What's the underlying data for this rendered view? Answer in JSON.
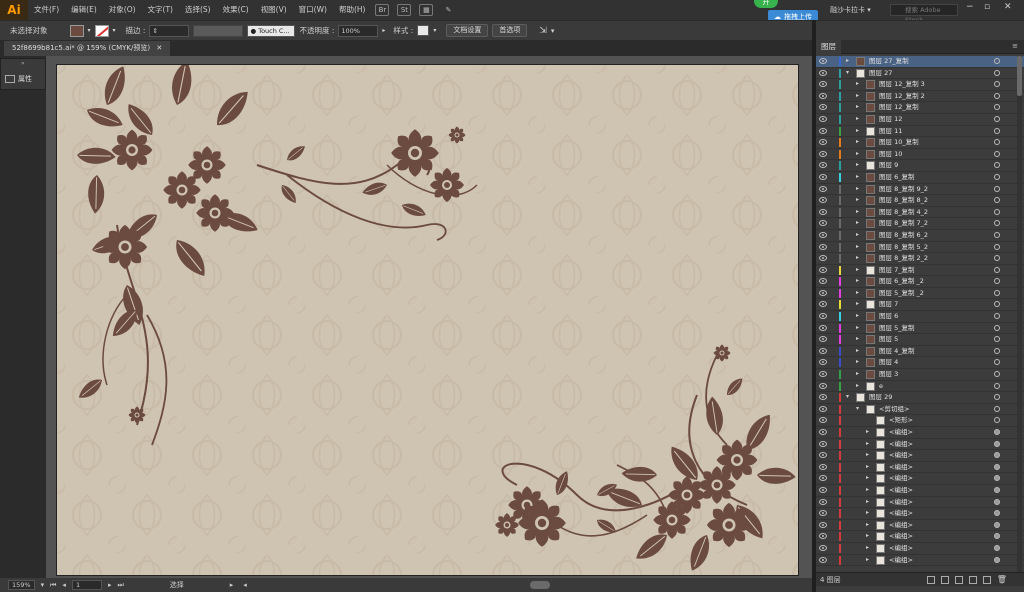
{
  "app": {
    "logo": "Ai",
    "menu": [
      "文件(F)",
      "编辑(E)",
      "对象(O)",
      "文字(T)",
      "选择(S)",
      "效果(C)",
      "视图(V)",
      "窗口(W)",
      "帮助(H)"
    ],
    "menu_icons": [
      "Br",
      "St",
      "grid-icon",
      "brush-launch-icon"
    ],
    "sync_label": "拖拽上传",
    "green_badge": "开",
    "workspace": "融沙卡拉卡",
    "stock_placeholder": "搜索 Adobe Stock"
  },
  "controlbar": {
    "selection_status": "未选择对象",
    "stroke_label": "描边 :",
    "brush": "Touch C...",
    "opacity_label": "不透明度 :",
    "opacity_value": "100%",
    "style_label": "样式 :",
    "doc_setup": "文档设置",
    "preferences": "首选项"
  },
  "document": {
    "tab_title": "52f8699b81c5.ai* @ 159% (CMYK/预览)"
  },
  "tools": {
    "properties_label": "属性"
  },
  "statusbar": {
    "zoom": "159%",
    "artboard_num": "1",
    "tool_status": "选择"
  },
  "colors": {
    "artboard_bg": "#cfc3b1",
    "ornament": "#6b4a40",
    "selected_row": "#4a6284"
  },
  "layers": {
    "tab_label": "图层",
    "footer_count": "4 图层",
    "rows": [
      {
        "name": "图层 27_复制",
        "indent": 0,
        "expand": "right",
        "color": "#3b6ad6",
        "thumb": "dark",
        "selected": true,
        "target": false
      },
      {
        "name": "图层 27",
        "indent": 0,
        "expand": "down",
        "color": "#2e9e9e",
        "thumb": "light",
        "selected": false,
        "target": false
      },
      {
        "name": "图层 12_复制 3",
        "indent": 1,
        "expand": "right",
        "color": "#2e9e9e",
        "thumb": "dark",
        "selected": false,
        "target": false
      },
      {
        "name": "图层 12_复制 2",
        "indent": 1,
        "expand": "right",
        "color": "#2e9e9e",
        "thumb": "dark",
        "selected": false,
        "target": false
      },
      {
        "name": "图层 12_复制",
        "indent": 1,
        "expand": "right",
        "color": "#2e9e9e",
        "thumb": "dark",
        "selected": false,
        "target": false
      },
      {
        "name": "图层 12",
        "indent": 1,
        "expand": "right",
        "color": "#2e9e9e",
        "thumb": "dark",
        "selected": false,
        "target": false
      },
      {
        "name": "图层 11",
        "indent": 1,
        "expand": "right",
        "color": "#3aa047",
        "thumb": "light",
        "selected": false,
        "target": false
      },
      {
        "name": "图层 10_复制",
        "indent": 1,
        "expand": "right",
        "color": "#e07b1f",
        "thumb": "dark",
        "selected": false,
        "target": false
      },
      {
        "name": "图层 10",
        "indent": 1,
        "expand": "right",
        "color": "#e07b1f",
        "thumb": "dark",
        "selected": false,
        "target": false
      },
      {
        "name": "图层 9",
        "indent": 1,
        "expand": "right",
        "color": "#2e9e9e",
        "thumb": "light",
        "selected": false,
        "target": false
      },
      {
        "name": "图层 6_复制",
        "indent": 1,
        "expand": "right",
        "color": "#39d0e0",
        "thumb": "dark",
        "selected": false,
        "target": false
      },
      {
        "name": "图层 8_复制 9_2",
        "indent": 1,
        "expand": "right",
        "color": "#6a6a6a",
        "thumb": "dark",
        "selected": false,
        "target": false
      },
      {
        "name": "图层 8_复制 8_2",
        "indent": 1,
        "expand": "right",
        "color": "#6a6a6a",
        "thumb": "dark",
        "selected": false,
        "target": false
      },
      {
        "name": "图层 8_复制 4_2",
        "indent": 1,
        "expand": "right",
        "color": "#6a6a6a",
        "thumb": "dark",
        "selected": false,
        "target": false
      },
      {
        "name": "图层 8_复制 7_2",
        "indent": 1,
        "expand": "right",
        "color": "#6a6a6a",
        "thumb": "dark",
        "selected": false,
        "target": false
      },
      {
        "name": "图层 8_复制 6_2",
        "indent": 1,
        "expand": "right",
        "color": "#6a6a6a",
        "thumb": "dark",
        "selected": false,
        "target": false
      },
      {
        "name": "图层 8_复制 5_2",
        "indent": 1,
        "expand": "right",
        "color": "#6a6a6a",
        "thumb": "dark",
        "selected": false,
        "target": false
      },
      {
        "name": "图层 8_复制 2_2",
        "indent": 1,
        "expand": "right",
        "color": "#6a6a6a",
        "thumb": "dark",
        "selected": false,
        "target": false
      },
      {
        "name": "图层 7_复制",
        "indent": 1,
        "expand": "right",
        "color": "#e8d93a",
        "thumb": "light",
        "selected": false,
        "target": false
      },
      {
        "name": "图层 6_复制 _2",
        "indent": 1,
        "expand": "right",
        "color": "#e040e0",
        "thumb": "dark",
        "selected": false,
        "target": false
      },
      {
        "name": "图层 5_复制 _2",
        "indent": 1,
        "expand": "right",
        "color": "#e040e0",
        "thumb": "dark",
        "selected": false,
        "target": false
      },
      {
        "name": "图层 7",
        "indent": 1,
        "expand": "right",
        "color": "#e8d93a",
        "thumb": "light",
        "selected": false,
        "target": false
      },
      {
        "name": "图层 6",
        "indent": 1,
        "expand": "right",
        "color": "#39d0e0",
        "thumb": "dark",
        "selected": false,
        "target": false
      },
      {
        "name": "图层 5_复制",
        "indent": 1,
        "expand": "right",
        "color": "#e040e0",
        "thumb": "dark",
        "selected": false,
        "target": false
      },
      {
        "name": "图层 5",
        "indent": 1,
        "expand": "right",
        "color": "#e040e0",
        "thumb": "dark",
        "selected": false,
        "target": false
      },
      {
        "name": "图层 4_复制",
        "indent": 1,
        "expand": "right",
        "color": "#3b4fc8",
        "thumb": "dark",
        "selected": false,
        "target": false
      },
      {
        "name": "图层 4",
        "indent": 1,
        "expand": "right",
        "color": "#3b4fc8",
        "thumb": "dark",
        "selected": false,
        "target": false
      },
      {
        "name": "图层 3",
        "indent": 1,
        "expand": "right",
        "color": "#3aa047",
        "thumb": "dark",
        "selected": false,
        "target": false
      },
      {
        "name": "e",
        "indent": 1,
        "expand": "right",
        "color": "#3aa047",
        "thumb": "light",
        "selected": false,
        "target": false
      },
      {
        "name": "图层 29",
        "indent": 0,
        "expand": "down",
        "color": "#d23c3c",
        "thumb": "light",
        "selected": false,
        "target": false
      },
      {
        "name": "<剪切组>",
        "indent": 1,
        "expand": "down",
        "color": "#d23c3c",
        "thumb": "light",
        "selected": false,
        "target": false
      },
      {
        "name": "<矩形>",
        "indent": 2,
        "expand": "none",
        "color": "#d23c3c",
        "thumb": "light",
        "selected": false,
        "target": false
      },
      {
        "name": "<编组>",
        "indent": 2,
        "expand": "right",
        "color": "#d23c3c",
        "thumb": "light",
        "selected": false,
        "target": true
      },
      {
        "name": "<编组>",
        "indent": 2,
        "expand": "right",
        "color": "#d23c3c",
        "thumb": "light",
        "selected": false,
        "target": true
      },
      {
        "name": "<编组>",
        "indent": 2,
        "expand": "right",
        "color": "#d23c3c",
        "thumb": "light",
        "selected": false,
        "target": true
      },
      {
        "name": "<编组>",
        "indent": 2,
        "expand": "right",
        "color": "#d23c3c",
        "thumb": "light",
        "selected": false,
        "target": true
      },
      {
        "name": "<编组>",
        "indent": 2,
        "expand": "right",
        "color": "#d23c3c",
        "thumb": "light",
        "selected": false,
        "target": true
      },
      {
        "name": "<编组>",
        "indent": 2,
        "expand": "right",
        "color": "#d23c3c",
        "thumb": "light",
        "selected": false,
        "target": true
      },
      {
        "name": "<编组>",
        "indent": 2,
        "expand": "right",
        "color": "#d23c3c",
        "thumb": "light",
        "selected": false,
        "target": true
      },
      {
        "name": "<编组>",
        "indent": 2,
        "expand": "right",
        "color": "#d23c3c",
        "thumb": "light",
        "selected": false,
        "target": true
      },
      {
        "name": "<编组>",
        "indent": 2,
        "expand": "right",
        "color": "#d23c3c",
        "thumb": "light",
        "selected": false,
        "target": true
      },
      {
        "name": "<编组>",
        "indent": 2,
        "expand": "right",
        "color": "#d23c3c",
        "thumb": "light",
        "selected": false,
        "target": true
      },
      {
        "name": "<编组>",
        "indent": 2,
        "expand": "right",
        "color": "#d23c3c",
        "thumb": "light",
        "selected": false,
        "target": true
      },
      {
        "name": "<编组>",
        "indent": 2,
        "expand": "right",
        "color": "#d23c3c",
        "thumb": "light",
        "selected": false,
        "target": true
      }
    ]
  }
}
